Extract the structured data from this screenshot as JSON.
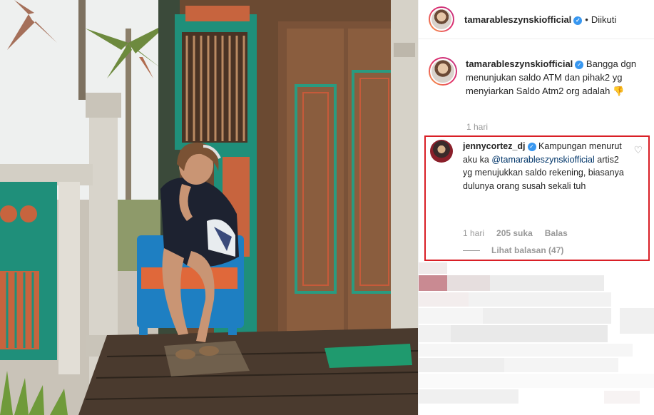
{
  "header": {
    "username": "tamarableszynskiofficial",
    "separator": "•",
    "follow_status": "Diikuti",
    "verified_icon": "check-badge-icon"
  },
  "caption": {
    "username": "tamarableszynskiofficial",
    "text": "Bangga dgn menunjukan saldo ATM dan pihak2 yg menyiarkan Saldo Atm2 org adalah 👎",
    "time": "1 hari"
  },
  "comment": {
    "username": "jennycortez_dj",
    "text_before": "Kampungan menurut aku ka",
    "mention": "@tamarableszynskiofficial",
    "text_after": "artis2 yg menujukkan saldo rekening, biasanya dulunya orang susah sekali tuh",
    "time": "1 hari",
    "likes": "205 suka",
    "reply_label": "Balas",
    "view_replies": "Lihat balasan (47)",
    "highlight_color": "#d91f26",
    "like_icon": "heart-outline-icon"
  },
  "colors": {
    "verified": "#3897f0",
    "muted": "#999999",
    "mention": "#003569"
  }
}
